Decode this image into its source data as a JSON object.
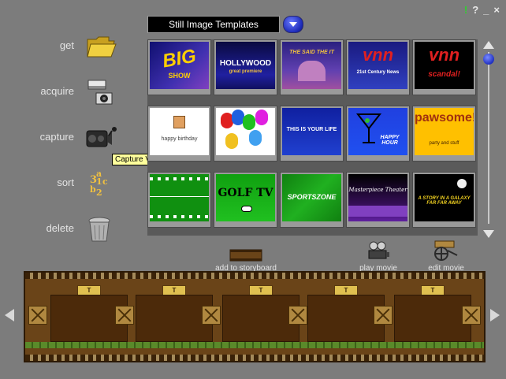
{
  "window_controls": {
    "ex": "!",
    "help": "?",
    "min": "_",
    "close": "×"
  },
  "nav": {
    "get": "get",
    "acquire": "acquire",
    "capture": "capture",
    "sort": "sort",
    "delete": "delete",
    "tooltip": "Capture Video",
    "sort_glyph_a": "3",
    "sort_glyph_b": "1",
    "sort_glyph_c": "a",
    "sort_glyph_d": "b",
    "sort_glyph_e": "2",
    "sort_glyph_f": "c"
  },
  "header": {
    "dropdown_value": "Still Image Templates"
  },
  "templates": [
    {
      "text": "BIG",
      "sub": "SHOW"
    },
    {
      "text": "HOLLYWOOD",
      "sub": "great premiere"
    },
    {
      "text": "THE SAID THE IT",
      "sub": ""
    },
    {
      "text": "vnn",
      "sub": "21st Century News"
    },
    {
      "text": "vnn",
      "sub": "scandal!"
    },
    {
      "text": "happy birthday",
      "sub": ""
    },
    {
      "text": "",
      "sub": ""
    },
    {
      "text": "THIS IS YOUR LIFE",
      "sub": ""
    },
    {
      "text": "HAPPY HOUR",
      "sub": ""
    },
    {
      "text": "pawsome!",
      "sub": "party and stuff"
    },
    {
      "text": "",
      "sub": ""
    },
    {
      "text": "GOLF TV",
      "sub": ""
    },
    {
      "text": "SPORTSZONE",
      "sub": ""
    },
    {
      "text": "Masterpiece Theater",
      "sub": ""
    },
    {
      "text": "A STORY IN A GALAXY FAR FAR AWAY",
      "sub": ""
    }
  ],
  "actions": {
    "add_storyboard": "add to storyboard",
    "play_movie": "play movie",
    "edit_movie": "edit movie"
  },
  "storyboard": {
    "tag_label": "T"
  },
  "colors": {
    "accent": "#2030c0",
    "tooltip": "#ffff9c",
    "film": "#6a4418"
  }
}
